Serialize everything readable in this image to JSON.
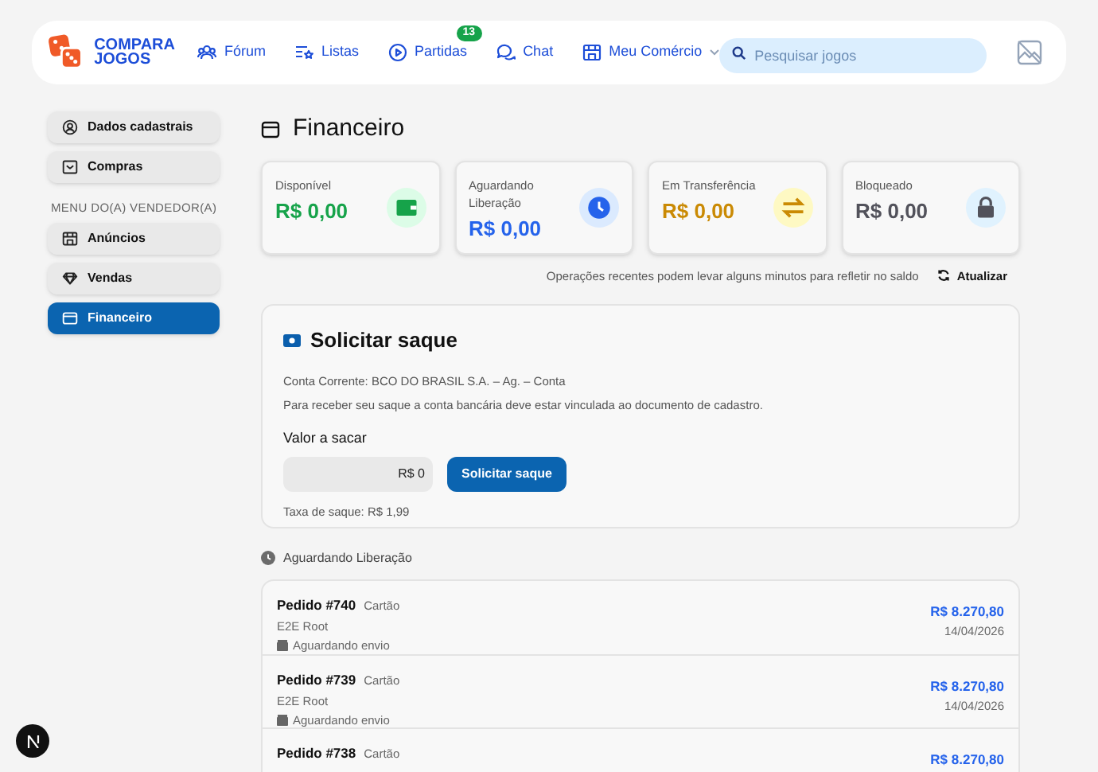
{
  "header": {
    "logo": [
      "COMPARA",
      "JOGOS"
    ],
    "nav": [
      {
        "label": "Fórum",
        "kind": "forum"
      },
      {
        "label": "Listas",
        "kind": "lists"
      },
      {
        "label": "Partidas",
        "kind": "matches",
        "badge": "13"
      },
      {
        "label": "Chat",
        "kind": "chat"
      },
      {
        "label": "Meu Comércio",
        "kind": "store",
        "dropdown": true
      }
    ],
    "search": {
      "placeholder": "Pesquisar jogos"
    }
  },
  "sidebar": {
    "items": [
      {
        "label": "Dados cadastrais",
        "kind": "user",
        "selected": false
      },
      {
        "label": "Compras",
        "kind": "inbox",
        "selected": false
      },
      {
        "kind": "heading",
        "label": "MENU DO(A) VENDEDOR(A)"
      },
      {
        "label": "Anúncios",
        "kind": "store",
        "selected": false
      },
      {
        "label": "Vendas",
        "kind": "diamond",
        "selected": false
      },
      {
        "label": "Financeiro",
        "kind": "wallet",
        "selected": true
      }
    ]
  },
  "page": {
    "title": "Financeiro",
    "cards": [
      {
        "label": "Disponível",
        "value": "R$ 0,00",
        "kind": "wallet",
        "color": "#16a34a"
      },
      {
        "label": "Aguardando Liberação",
        "value": "R$ 0,00",
        "kind": "clock",
        "color": "#2563eb"
      },
      {
        "label": "Em Transferência",
        "value": "R$ 0,00",
        "kind": "transfer",
        "color": "#ca8a04"
      },
      {
        "label": "Bloqueado",
        "value": "R$ 0,00",
        "kind": "lock",
        "color": "#52525b"
      }
    ],
    "note": "Operações recentes podem levar alguns minutos para refletir no saldo",
    "refresh": "Atualizar"
  },
  "withdraw": {
    "title": "Solicitar saque",
    "account": "Conta Corrente: BCO DO BRASIL S.A. – Ag. – Conta",
    "info": "Para receber seu saque a conta bancária deve estar vinculada ao documento de cadastro.",
    "amount_label": "Valor a sacar",
    "amount": "R$ 0",
    "button": "Solicitar saque",
    "fee": "Taxa de saque: R$ 1,99"
  },
  "pending": {
    "title": "Aguardando Liberação",
    "orders": [
      {
        "order": "Pedido #740",
        "method": "Cartão",
        "buyer": "E2E Root",
        "status": "Aguardando envio",
        "amount": "R$ 8.270,80",
        "date": "14/04/2026"
      },
      {
        "order": "Pedido #739",
        "method": "Cartão",
        "buyer": "E2E Root",
        "status": "Aguardando envio",
        "amount": "R$ 8.270,80",
        "date": "14/04/2026"
      },
      {
        "order": "Pedido #738",
        "method": "Cartão",
        "amount": "R$ 8.270,80"
      }
    ]
  }
}
